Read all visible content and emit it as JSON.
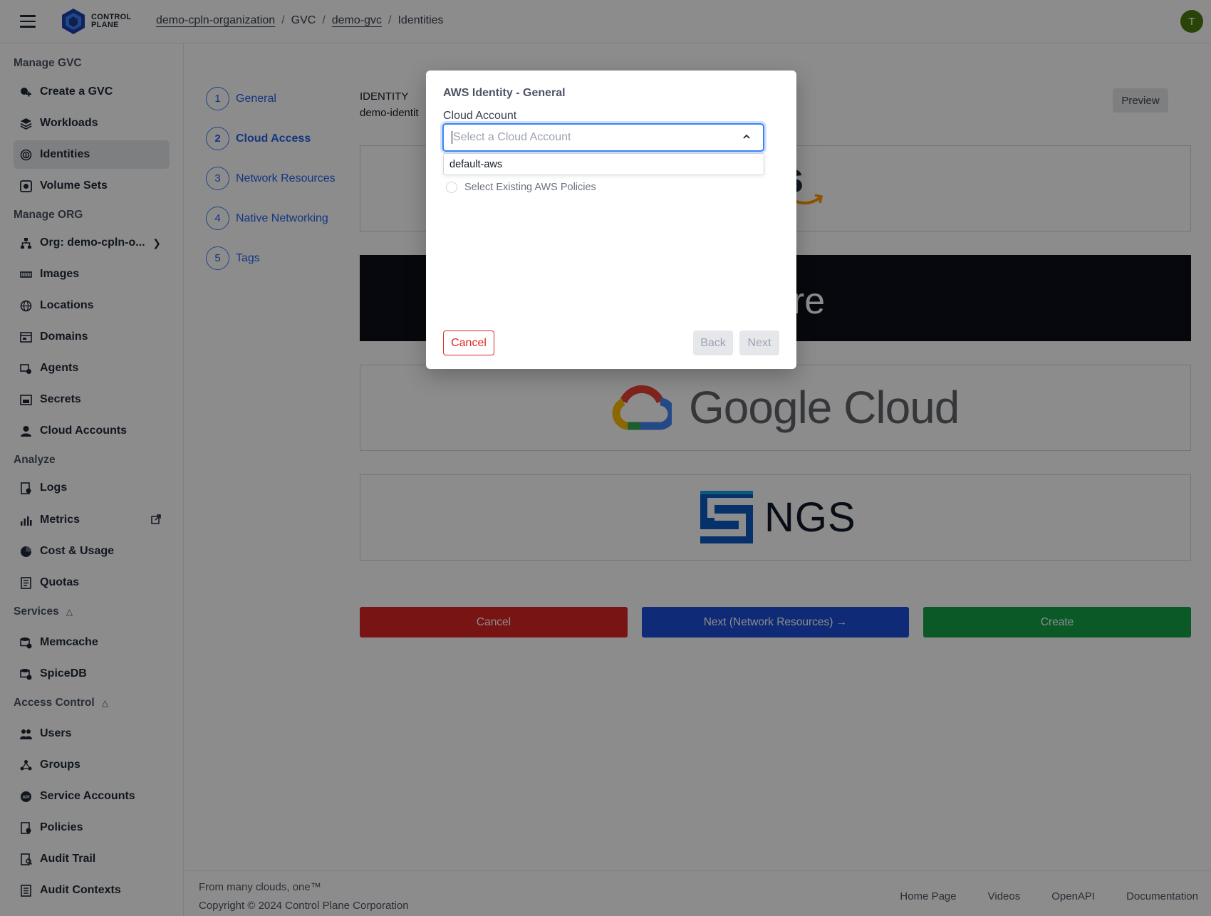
{
  "header": {
    "logo_line1": "CONTROL",
    "logo_line2": "PLANE",
    "breadcrumb": [
      "demo-cpln-organization",
      "GVC",
      "demo-gvc",
      "Identities"
    ],
    "avatar_initial": "T"
  },
  "sidebar": {
    "sections": {
      "manage_gvc": "Manage GVC",
      "manage_org": "Manage ORG",
      "analyze": "Analyze",
      "services": "Services",
      "access_control": "Access Control"
    },
    "items": [
      {
        "label": "Create a GVC",
        "icon": "gvc-create-icon"
      },
      {
        "label": "Workloads",
        "icon": "layers-icon"
      },
      {
        "label": "Identities",
        "icon": "fingerprint-icon"
      },
      {
        "label": "Volume Sets",
        "icon": "disk-icon"
      },
      {
        "label": "Org: demo-cpln-o...",
        "icon": "org-tree-icon"
      },
      {
        "label": "Images",
        "icon": "image-icon"
      },
      {
        "label": "Locations",
        "icon": "globe-icon"
      },
      {
        "label": "Domains",
        "icon": "domain-icon"
      },
      {
        "label": "Agents",
        "icon": "agent-icon"
      },
      {
        "label": "Secrets",
        "icon": "secret-icon"
      },
      {
        "label": "Cloud Accounts",
        "icon": "cloud-account-icon"
      },
      {
        "label": "Logs",
        "icon": "logs-icon"
      },
      {
        "label": "Metrics",
        "icon": "metrics-icon"
      },
      {
        "label": "Cost & Usage",
        "icon": "pie-icon"
      },
      {
        "label": "Quotas",
        "icon": "quota-icon"
      },
      {
        "label": "Memcache",
        "icon": "memcache-icon"
      },
      {
        "label": "SpiceDB",
        "icon": "spicedb-icon"
      },
      {
        "label": "Users",
        "icon": "users-icon"
      },
      {
        "label": "Groups",
        "icon": "groups-icon"
      },
      {
        "label": "Service Accounts",
        "icon": "service-account-icon"
      },
      {
        "label": "Policies",
        "icon": "policy-icon"
      },
      {
        "label": "Audit Trail",
        "icon": "audit-trail-icon"
      },
      {
        "label": "Audit Contexts",
        "icon": "audit-context-icon"
      }
    ]
  },
  "stepper": {
    "steps": [
      {
        "num": "1",
        "label": "General"
      },
      {
        "num": "2",
        "label": "Cloud Access"
      },
      {
        "num": "3",
        "label": "Network Resources"
      },
      {
        "num": "4",
        "label": "Native Networking"
      },
      {
        "num": "5",
        "label": "Tags"
      }
    ]
  },
  "main": {
    "identity_label": "IDENTITY",
    "identity_value": "demo-identit",
    "preview_label": "Preview",
    "providers": {
      "aws_visible": "s",
      "azure_visible": "ure",
      "gcp": "Google Cloud",
      "ngs": "NGS"
    },
    "cancel_label": "Cancel",
    "next_label": "Next (Network Resources) →",
    "create_label": "Create"
  },
  "modal": {
    "title": "AWS Identity - General",
    "field_label": "Cloud Account",
    "select_placeholder": "Select a Cloud Account",
    "options": [
      "default-aws"
    ],
    "radio_label": "Select Existing AWS Policies",
    "cancel_label": "Cancel",
    "back_label": "Back",
    "next_label": "Next"
  },
  "footer": {
    "tagline": "From many clouds, one™",
    "copyright": "Copyright © 2024 Control Plane Corporation",
    "links": [
      "Home Page",
      "Videos",
      "OpenAPI",
      "Documentation"
    ]
  },
  "colors": {
    "accent_blue": "#2563eb",
    "danger_red": "#dc2626",
    "success_green": "#16a34a",
    "azure_bg": "#0b0f19"
  }
}
